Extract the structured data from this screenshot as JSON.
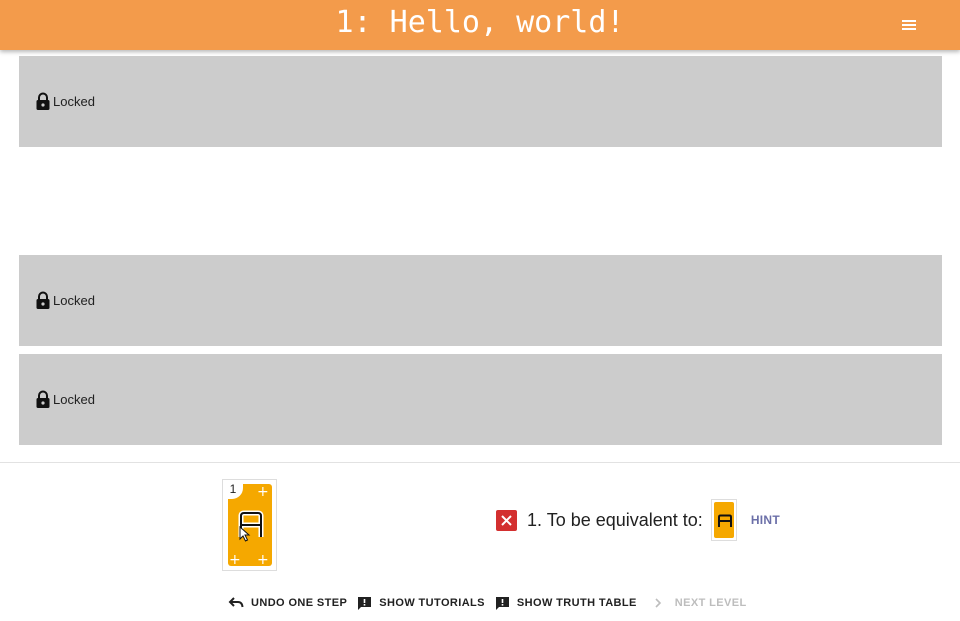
{
  "header": {
    "title": "1: Hello, world!",
    "menu_icon": "menu-icon"
  },
  "levels": [
    {
      "status": "Locked",
      "icon": "lock-icon"
    },
    {
      "status": "Locked",
      "icon": "lock-icon"
    },
    {
      "status": "Locked",
      "icon": "lock-icon"
    }
  ],
  "hand": {
    "card_number": "1",
    "card_color": "#f5a800"
  },
  "goal": {
    "status_icon": "error-x-icon",
    "status_color": "#d32f2f",
    "text": "1. To be equivalent to:",
    "hint_label": "HINT"
  },
  "toolbar": {
    "undo_label": "UNDO ONE STEP",
    "tutorials_label": "SHOW TUTORIALS",
    "truth_table_label": "SHOW TRUTH TABLE",
    "next_label": "NEXT LEVEL",
    "next_enabled": false
  },
  "colors": {
    "appbar": "#f39b4b",
    "panel": "#cccccc",
    "hint": "#6b6fa8"
  }
}
